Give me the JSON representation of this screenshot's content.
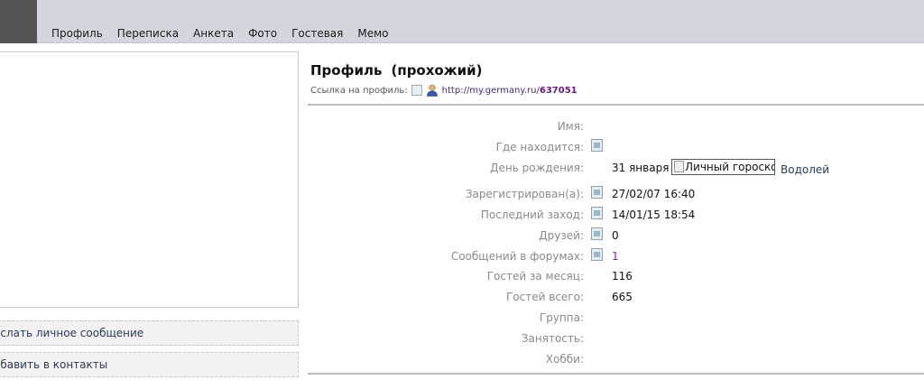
{
  "nav": {
    "items": [
      "Профиль",
      "Переписка",
      "Анкета",
      "Фото",
      "Гостевая",
      "Мемо"
    ]
  },
  "sidebar": {
    "actions": [
      "ослать личное сообщение",
      "обавить в контакты"
    ]
  },
  "profile": {
    "title": "Профиль",
    "subtitle": "(прохожий)",
    "link_label": "Ссылка на профиль:",
    "link_prefix": "http://my.germany.ru/",
    "link_id": "637051",
    "fields": [
      {
        "label": "Имя:",
        "value": ""
      },
      {
        "label": "Где находится:",
        "value": ""
      },
      {
        "label": "День рождения:",
        "value": "31 января"
      },
      {
        "label": "Зарегистрирован(а):",
        "value": "27/02/07 16:40"
      },
      {
        "label": "Последний заход:",
        "value": "14/01/15 18:54"
      },
      {
        "label": "Друзей:",
        "value": "0"
      },
      {
        "label": "Сообщений в форумах:",
        "value": "1"
      },
      {
        "label": "Гостей за месяц:",
        "value": "116"
      },
      {
        "label": "Гостей всего:",
        "value": "665"
      },
      {
        "label": "Группа:",
        "value": ""
      },
      {
        "label": "Занятость:",
        "value": ""
      },
      {
        "label": "Хобби:",
        "value": ""
      }
    ],
    "horoscope_alt": "Личный гороскоп",
    "zodiac_sign": "Водолей"
  },
  "colors": {
    "topbar": "#d3d6dd",
    "label": "#8a8a8a",
    "link": "#4a2a7a"
  },
  "icons": [
    "image-placeholder-icon",
    "user-icon"
  ]
}
